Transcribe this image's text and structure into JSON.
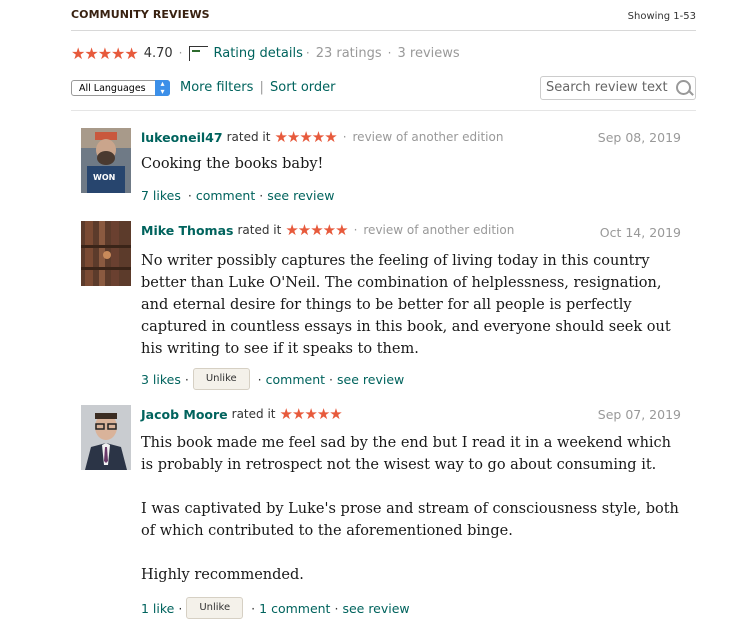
{
  "header": {
    "title": "COMMUNITY REVIEWS",
    "showing": "Showing 1-53"
  },
  "summary": {
    "stars": "★★★★★",
    "average": "4.70",
    "rating_details": "Rating details",
    "ratings": "23 ratings",
    "reviews": "3 reviews",
    "star_color": "#e75a3c"
  },
  "filters": {
    "language": "All Languages",
    "more_filters": "More filters",
    "divider": "|",
    "sort_order": "Sort order",
    "search_placeholder": "Search review text"
  },
  "reviews": [
    {
      "name": "lukeoneil47",
      "rated": "rated it",
      "stars": "★★★★★",
      "edition_note": "review of another edition",
      "date": "Sep 08, 2019",
      "body": [
        "Cooking the books baby!"
      ],
      "likes": "7 likes",
      "comment": "comment",
      "see_review": "see review"
    },
    {
      "name": "Mike Thomas",
      "rated": "rated it",
      "stars": "★★★★★",
      "edition_note": "review of another edition",
      "date": "Oct 14, 2019",
      "body": [
        "No writer possibly captures the feeling of living today in this country better than Luke O'Neil. The combination of helplessness, resignation, and eternal desire for things to be better for all people is perfectly captured in countless essays in this book, and everyone should seek out his writing to see if it speaks to them."
      ],
      "likes": "3 likes",
      "unlike": "Unlike",
      "comment": "comment",
      "see_review": "see review"
    },
    {
      "name": "Jacob Moore",
      "rated": "rated it",
      "stars": "★★★★★",
      "date": "Sep 07, 2019",
      "body": [
        "This book made me feel sad by the end but I read it in a weekend which is probably in retrospect not the wisest way to go about consuming it.",
        "I was captivated by Luke's prose and stream of consciousness style, both of which contributed to the aforementioned binge.",
        "Highly recommended."
      ],
      "likes": "1 like",
      "unlike": "Unlike",
      "comment": "1 comment",
      "see_review": "see review"
    }
  ]
}
